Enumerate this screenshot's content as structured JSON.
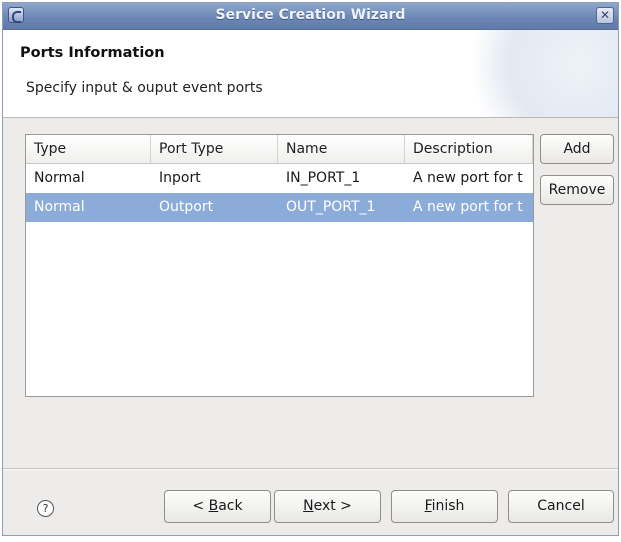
{
  "window": {
    "title": "Service Creation Wizard",
    "close_glyph": "✕",
    "app_icon": "eclipse-icon"
  },
  "header": {
    "title": "Ports Information",
    "description": "Specify input & ouput event ports"
  },
  "table": {
    "columns": [
      "Type",
      "Port Type",
      "Name",
      "Description"
    ],
    "rows": [
      {
        "type": "Normal",
        "port_type": "Inport",
        "name": "IN_PORT_1",
        "description": "A new port for t",
        "selected": false
      },
      {
        "type": "Normal",
        "port_type": "Outport",
        "name": "OUT_PORT_1",
        "description": "A new port for t",
        "selected": true
      }
    ]
  },
  "side_buttons": {
    "add": "Add",
    "remove": "Remove"
  },
  "footer": {
    "help_glyph": "?",
    "back": {
      "prefix": "< ",
      "mnemonic": "B",
      "rest": "ack"
    },
    "next": {
      "mnemonic": "N",
      "rest": "ext >"
    },
    "finish": {
      "mnemonic": "F",
      "rest": "inish"
    },
    "cancel": "Cancel"
  },
  "colors": {
    "selection": "#8bacd8",
    "titlebar": "#6d88b6"
  }
}
